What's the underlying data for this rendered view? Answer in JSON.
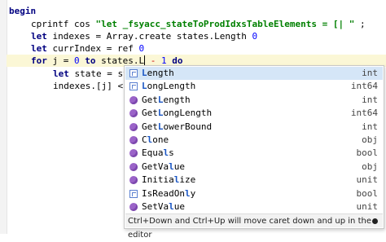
{
  "code": {
    "l1": "begin",
    "l2_a": "cprintf cos ",
    "l2_str": "\"let _fsyacc_stateToProdIdxsTableElements = [| \"",
    "l2_b": " ;",
    "l3_kw": "let",
    "l3_a": " indexes = Array.create states.Length ",
    "l3_num": "0",
    "l4_kw": "let",
    "l4_a": " currIndex = ref ",
    "l4_num": "0",
    "l5_kw1": "for",
    "l5_a": " j = ",
    "l5_num1": "0",
    "l5_kw2": " to",
    "l5_b": " states.L",
    "l5_c": " - ",
    "l5_num2": "1",
    "l5_kw3": " do",
    "l6_kw": "let",
    "l6_a": " state = st",
    "l7_a": "indexes.[j] <"
  },
  "completion": {
    "items": [
      {
        "match": "L",
        "rest": "ength",
        "type": "int",
        "icon": "property-icon",
        "selected": true
      },
      {
        "match": "L",
        "rest": "ongLength",
        "type": "int64",
        "icon": "property-icon"
      },
      {
        "pre": "Get",
        "match": "L",
        "rest": "ength",
        "type": "int",
        "icon": "method-icon"
      },
      {
        "pre": "Get",
        "match": "L",
        "rest": "ongLength",
        "type": "int64",
        "icon": "method-icon"
      },
      {
        "pre": "Get",
        "match": "L",
        "rest": "owerBound",
        "type": "int",
        "icon": "method-icon"
      },
      {
        "pre": "C",
        "match": "l",
        "rest": "one",
        "type": "obj",
        "icon": "method-icon"
      },
      {
        "pre": "Equa",
        "match": "l",
        "rest": "s",
        "type": "bool",
        "icon": "method-icon"
      },
      {
        "pre": "GetVa",
        "match": "l",
        "rest": "ue",
        "type": "obj",
        "icon": "method-icon"
      },
      {
        "pre": "Initia",
        "match": "l",
        "rest": "ize",
        "type": "unit",
        "icon": "method-icon"
      },
      {
        "pre": "IsReadOn",
        "match": "l",
        "rest": "y",
        "type": "bool",
        "icon": "property-icon"
      },
      {
        "pre": "SetVa",
        "match": "l",
        "rest": "ue",
        "type": "unit",
        "icon": "method-icon"
      }
    ],
    "hint": "Ctrl+Down and Ctrl+Up will move caret down and up in the editor"
  }
}
